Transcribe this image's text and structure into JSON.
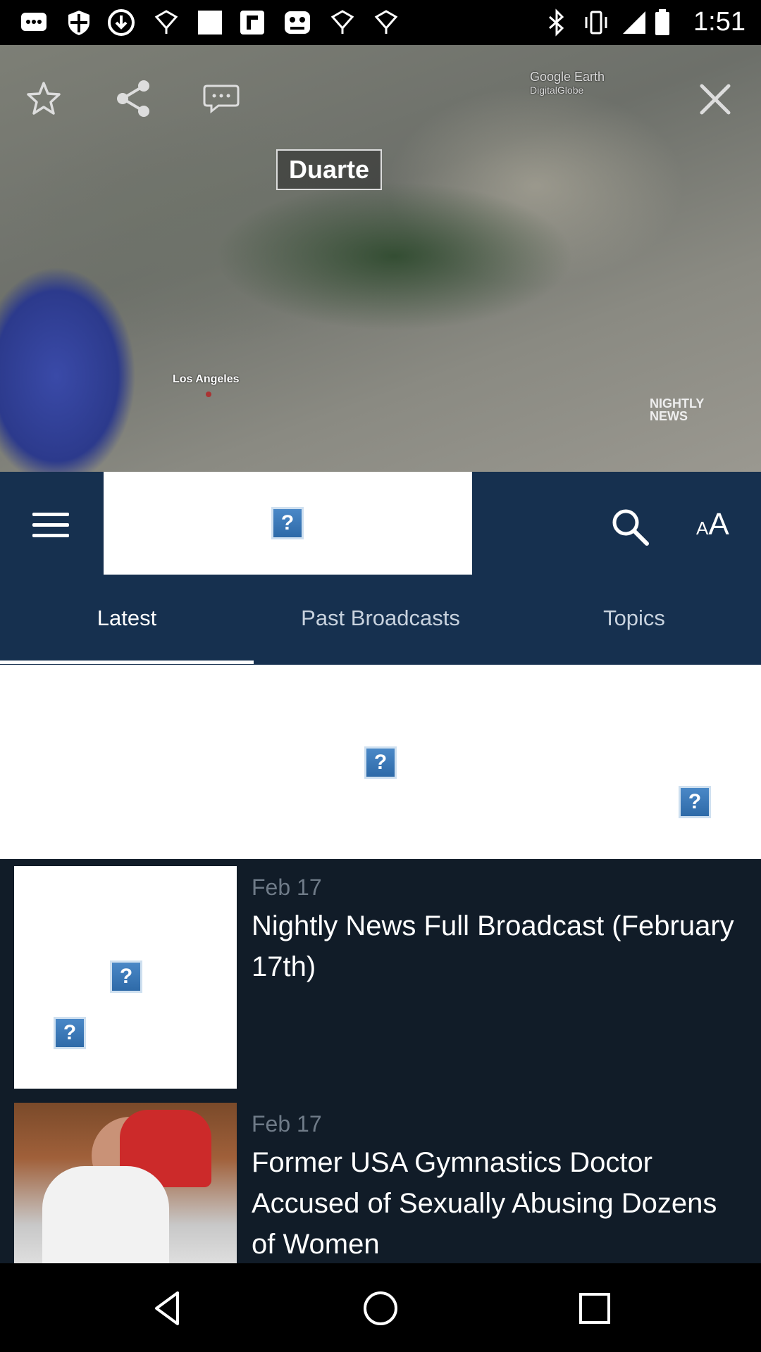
{
  "status_bar": {
    "time": "1:51",
    "icons": [
      "messages-icon",
      "shield-icon",
      "download-icon",
      "bulb-icon",
      "square-icon",
      "flipboard-icon",
      "game-icon",
      "bulb-icon",
      "bulb-icon",
      "bluetooth-icon",
      "vibrate-icon",
      "signal-icon",
      "battery-icon"
    ]
  },
  "video": {
    "map_label": "Duarte",
    "city_label": "Los Angeles",
    "watermark_top": "Google Earth",
    "watermark_top_sub": "DigitalGlobe",
    "watermark_brand": "NIGHTLY",
    "watermark_brand_sub": "NEWS",
    "controls": [
      "star-icon",
      "share-icon",
      "comment-icon",
      "close-icon"
    ]
  },
  "app_bar": {
    "font_small": "A",
    "font_big": "A",
    "tabs": [
      {
        "label": "Latest",
        "selected": true
      },
      {
        "label": "Past Broadcasts",
        "selected": false
      },
      {
        "label": "Topics",
        "selected": false
      }
    ]
  },
  "list": {
    "items": [
      {
        "date": "Feb 17",
        "title": "Nightly News Full Broadcast (February 17th)"
      },
      {
        "date": "Feb 17",
        "title": "Former USA Gymnastics Doctor Accused of Sexually Abusing Dozens of Women"
      }
    ]
  },
  "colors": {
    "app_bar": "#16304f",
    "list_bg": "#111c28",
    "date_text": "#6f7b88"
  }
}
